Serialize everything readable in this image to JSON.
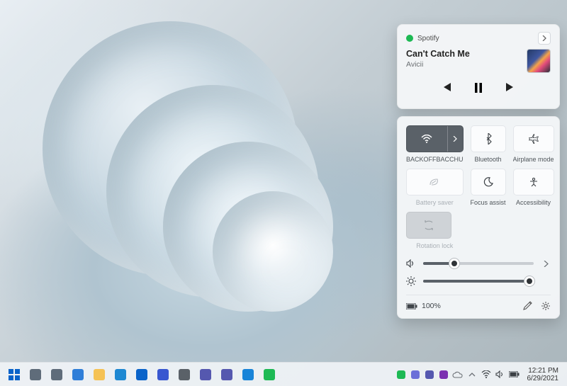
{
  "media": {
    "app_name": "Spotify",
    "track_title": "Can't Catch Me",
    "artist": "Avicii",
    "controls": {
      "prev": "previous-track",
      "playpause": "pause",
      "next": "next-track"
    }
  },
  "quick_settings": {
    "tiles": [
      {
        "id": "wifi",
        "label": "BACKOFFBACCHU",
        "active": true,
        "icon": "wifi-icon"
      },
      {
        "id": "bluetooth",
        "label": "Bluetooth",
        "active": false,
        "icon": "bluetooth-icon"
      },
      {
        "id": "airplane",
        "label": "Airplane mode",
        "active": false,
        "icon": "airplane-icon"
      },
      {
        "id": "battery_saver",
        "label": "Battery saver",
        "active": false,
        "disabled": true,
        "icon": "leaf-icon"
      },
      {
        "id": "focus_assist",
        "label": "Focus assist",
        "active": false,
        "icon": "moon-icon"
      },
      {
        "id": "accessibility",
        "label": "Accessibility",
        "active": false,
        "icon": "accessibility-icon"
      },
      {
        "id": "rotation_lock",
        "label": "Rotation lock",
        "active": false,
        "disabled": true,
        "icon": "rotation-icon"
      }
    ],
    "volume_percent": 28,
    "brightness_percent": 96,
    "battery_text": "100%",
    "footer_icons": {
      "edit": "pencil-icon",
      "settings": "gear-icon"
    }
  },
  "taskbar": {
    "apps": [
      {
        "id": "start",
        "name": "start-button",
        "color": "#0a63c9"
      },
      {
        "id": "search",
        "name": "search-icon",
        "color": "#5f6c7a"
      },
      {
        "id": "taskview",
        "name": "task-view-icon",
        "color": "#5f6c7a"
      },
      {
        "id": "widgets",
        "name": "widgets-icon",
        "color": "#2f7ed8"
      },
      {
        "id": "explorer",
        "name": "file-explorer-icon",
        "color": "#f5c255"
      },
      {
        "id": "edge",
        "name": "edge-icon",
        "color": "#1e88d2"
      },
      {
        "id": "mail",
        "name": "mail-icon",
        "color": "#0a63c9"
      },
      {
        "id": "todo",
        "name": "todo-icon",
        "color": "#3857d0"
      },
      {
        "id": "settings",
        "name": "settings-icon",
        "color": "#5a6168"
      },
      {
        "id": "teams1",
        "name": "teams-icon",
        "color": "#5558af"
      },
      {
        "id": "teams2",
        "name": "teams-chat-icon",
        "color": "#5558af"
      },
      {
        "id": "phone",
        "name": "your-phone-icon",
        "color": "#1884d8"
      },
      {
        "id": "spotify",
        "name": "spotify-icon",
        "color": "#1db954"
      }
    ],
    "tray": [
      {
        "id": "spotify-tray",
        "name": "spotify-tray-icon",
        "color": "#1db954"
      },
      {
        "id": "meet-now",
        "name": "meet-now-icon",
        "color": "#6b6fd8"
      },
      {
        "id": "teams-tray",
        "name": "teams-tray-icon",
        "color": "#5558af"
      },
      {
        "id": "onenote",
        "name": "onenote-tray-icon",
        "color": "#7b2fb0"
      },
      {
        "id": "onedrive",
        "name": "onedrive-icon",
        "color": "#6b7075"
      },
      {
        "id": "chevron",
        "name": "chevron-up-icon",
        "color": "#6b7075"
      },
      {
        "id": "wifi-tray",
        "name": "wifi-tray-icon",
        "color": "#3a3f44"
      },
      {
        "id": "volume-tray",
        "name": "volume-tray-icon",
        "color": "#3a3f44"
      },
      {
        "id": "battery-tray",
        "name": "battery-tray-icon",
        "color": "#3a3f44"
      }
    ],
    "time": "12:21 PM",
    "date": "6/29/2021"
  },
  "colors": {
    "accent_dark": "#5a6168",
    "panel_bg": "#f4f6f8"
  }
}
